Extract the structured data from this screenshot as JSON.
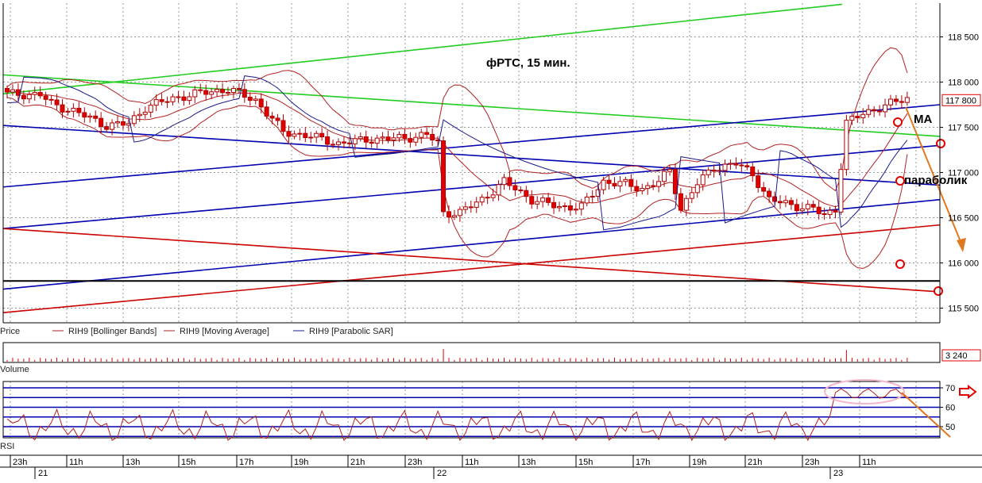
{
  "chart_data": {
    "type": "candlestick",
    "title": "фРТС,   15 мин.",
    "instrument": "RIH9",
    "price_scale": {
      "ylim": [
        115350,
        119000
      ],
      "ticks": [
        "118 500",
        "118 000",
        "117 500",
        "117 000",
        "116 500",
        "116 000",
        "115 500"
      ],
      "tick_values": [
        118500,
        118000,
        117500,
        117000,
        116500,
        116000,
        115500
      ],
      "last_price_label": "117 800",
      "last_price": 117800
    },
    "time_axis": {
      "hour_labels": [
        "23h",
        "11h",
        "13h",
        "15h",
        "17h",
        "19h",
        "21h",
        "23h",
        "11h",
        "13h",
        "15h",
        "17h",
        "19h",
        "21h",
        "23h",
        "11h"
      ],
      "day_labels": [
        "21",
        "22",
        "23"
      ]
    },
    "legend": {
      "price": "Price",
      "items": [
        {
          "name": "RIH9 [Bollinger Bands]",
          "color": "#b22222"
        },
        {
          "name": "RIH9 [Moving Average]",
          "color": "#b22222"
        },
        {
          "name": "RIH9 [Parabolic SAR]",
          "color": "#1a1a8c"
        }
      ]
    },
    "volume_panel": {
      "label": "Volume",
      "last_value_label": "3 240"
    },
    "rsi_panel": {
      "label": "RSI",
      "ticks": [
        "70",
        "60",
        "50"
      ],
      "tick_values": [
        70,
        60,
        50
      ],
      "levels": [
        70,
        65,
        60,
        55,
        50,
        45
      ],
      "ylim": [
        43,
        73
      ]
    },
    "annotations": {
      "ma": "MA",
      "parabolic": "параболик"
    },
    "colors": {
      "up_candle": "#ffffff",
      "down_candle": "#e00000",
      "candle_outline": "#b00000",
      "bollinger": "#b22222",
      "sar": "#1a1a8c",
      "trend_green": "#22cc22",
      "trend_blue": "#0000b0",
      "trend_red": "#cc0000",
      "support_black": "#000000",
      "arrow_orange": "#e07820",
      "circle_red": "#e00000",
      "rsi_line": "#b22222",
      "rsi_highlight": "#f0b8c8",
      "grid": "#999999"
    }
  }
}
